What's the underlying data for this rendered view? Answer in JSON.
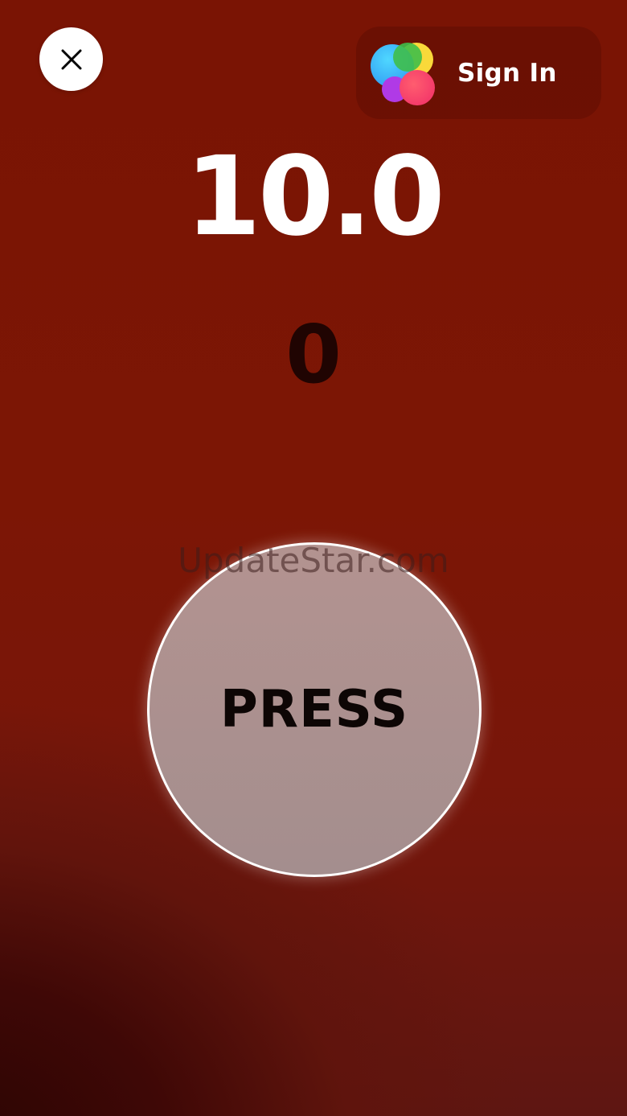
{
  "header": {
    "close_icon": "close-icon",
    "signin": {
      "icon": "game-center-icon",
      "label": "Sign In"
    }
  },
  "game": {
    "timer": "10.0",
    "score": "0",
    "press_label": "PRESS"
  },
  "watermark": "UpdateStar.com",
  "colors": {
    "background": "#7a1404",
    "button_fill": "#a8908f",
    "button_border": "#ffffff",
    "timer_text": "#ffffff",
    "score_text": "#200402"
  }
}
